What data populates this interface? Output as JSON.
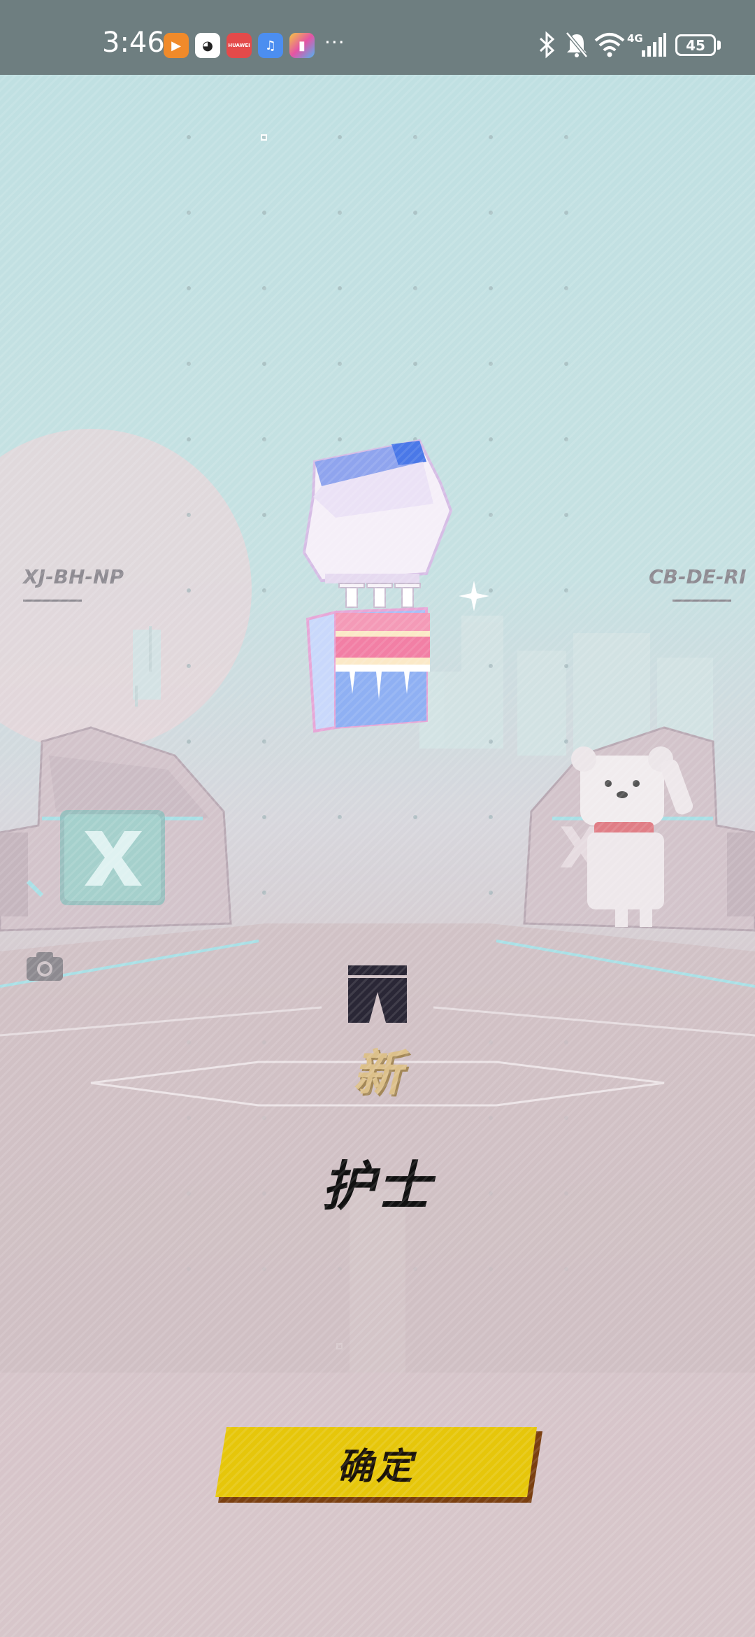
{
  "status_bar": {
    "time": "3:46",
    "notification_icons": [
      "video-app-icon",
      "qq-icon",
      "huawei-store-icon",
      "music-icon",
      "paint-app-icon"
    ],
    "huawei_store_text": "HUAWEI",
    "more_indicator": "···",
    "network_label": "4G",
    "battery_level": "45",
    "right_icons": [
      "bluetooth-icon",
      "mute-icon",
      "wifi-icon",
      "signal-icon",
      "battery-icon"
    ]
  },
  "scene": {
    "left_code": "XJ-BH-NP",
    "right_code": "CB-DE-RI"
  },
  "reward": {
    "new_badge": "新",
    "item_name": "护士"
  },
  "actions": {
    "confirm_label": "确定"
  },
  "colors": {
    "confirm_bg": "#e6c60a",
    "confirm_shadow": "#7a3f10",
    "new_badge": "#dcc08a",
    "status_bar": "#6e7e80"
  }
}
